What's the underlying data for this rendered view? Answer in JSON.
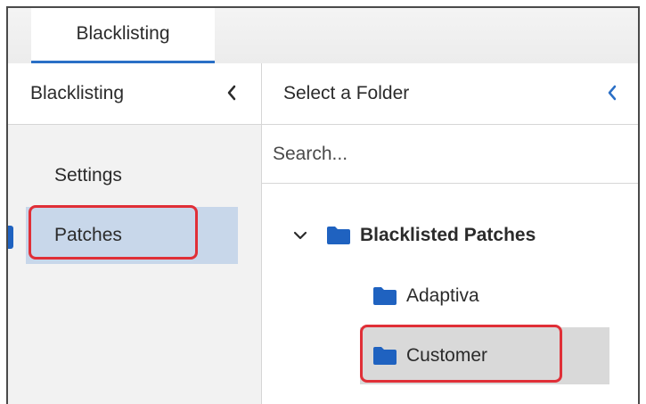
{
  "tabs": [
    {
      "label": "Blacklisting",
      "active": true
    }
  ],
  "left_pane": {
    "title": "Blacklisting",
    "collapse_icon": "chevron-left-icon",
    "items": [
      {
        "label": "Settings",
        "selected": false
      },
      {
        "label": "Patches",
        "selected": true
      }
    ]
  },
  "right_pane": {
    "title": "Select a Folder",
    "collapse_icon": "chevron-left-icon",
    "search": {
      "placeholder": "Search...",
      "value": ""
    },
    "tree": {
      "root": {
        "label": "Blacklisted Patches",
        "expanded": true,
        "icon": "folder-icon"
      },
      "children": [
        {
          "label": "Adaptiva",
          "icon": "folder-icon",
          "selected": false
        },
        {
          "label": "Customer",
          "icon": "folder-icon",
          "selected": true
        }
      ]
    }
  },
  "colors": {
    "accent": "#2a6fc6",
    "folder": "#1f62c0",
    "highlight": "#e02f37",
    "selected_nav": "#c8d7ea",
    "selected_tree": "#d9d9d9"
  }
}
